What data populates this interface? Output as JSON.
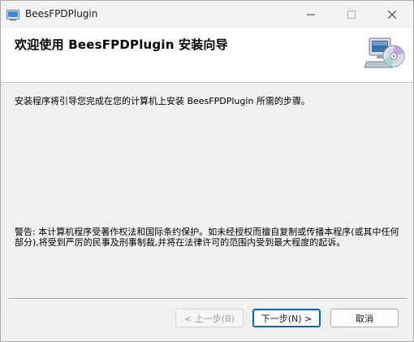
{
  "window": {
    "title": "BeesFPDPlugin"
  },
  "banner": {
    "title": "欢迎使用 BeesFPDPlugin 安装向导",
    "icon": "computer-cd-icon"
  },
  "content": {
    "intro": "安装程序将引导您完成在您的计算机上安装 BeesFPDPlugin 所需的步骤。",
    "warning": "警告: 本计算机程序受著作权法和国际条约保护。如未经授权而擅自复制或传播本程序(或其中任何部分),将受到严厉的民事及刑事制裁,并将在法律许可的范围内受到最大程度的起诉。"
  },
  "buttons": {
    "back": "< 上一步(B)",
    "next": "下一步(N) >",
    "cancel": "取消"
  },
  "colors": {
    "accent": "#0067c0",
    "disabled_text": "#a0a0a0"
  }
}
